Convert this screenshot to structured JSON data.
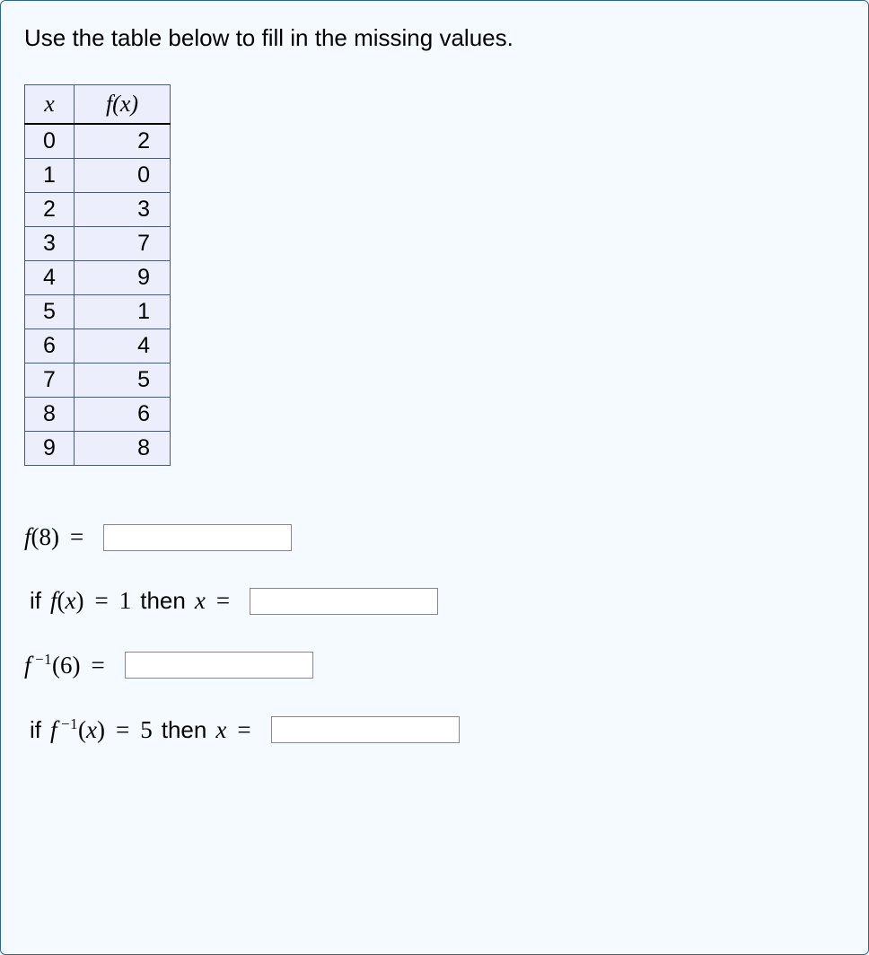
{
  "prompt": "Use the table below to fill in the missing values.",
  "table": {
    "headers": {
      "x": "x",
      "fx": "f(x)"
    },
    "rows": [
      {
        "x": "0",
        "fx": "2"
      },
      {
        "x": "1",
        "fx": "0"
      },
      {
        "x": "2",
        "fx": "3"
      },
      {
        "x": "3",
        "fx": "7"
      },
      {
        "x": "4",
        "fx": "9"
      },
      {
        "x": "5",
        "fx": "1"
      },
      {
        "x": "6",
        "fx": "4"
      },
      {
        "x": "7",
        "fx": "5"
      },
      {
        "x": "8",
        "fx": "6"
      },
      {
        "x": "9",
        "fx": "8"
      }
    ]
  },
  "questions": {
    "q1": {
      "lhs_f": "f",
      "lhs_arg": "(8)",
      "eq": " = "
    },
    "q2": {
      "if": "if ",
      "f": "f",
      "paren": "(",
      "var": "x",
      "close": ")",
      "eq1": " = ",
      "val": "1",
      "then": " then ",
      "var2": "x",
      "eq2": " = "
    },
    "q3": {
      "f": "f",
      "sup": " −1",
      "arg": "(6)",
      "eq": " = "
    },
    "q4": {
      "if": "if ",
      "f": "f",
      "sup": " −1",
      "paren": "(",
      "var": "x",
      "close": ")",
      "eq1": " = ",
      "val": "5",
      "then": " then ",
      "var2": "x",
      "eq2": " = "
    }
  }
}
